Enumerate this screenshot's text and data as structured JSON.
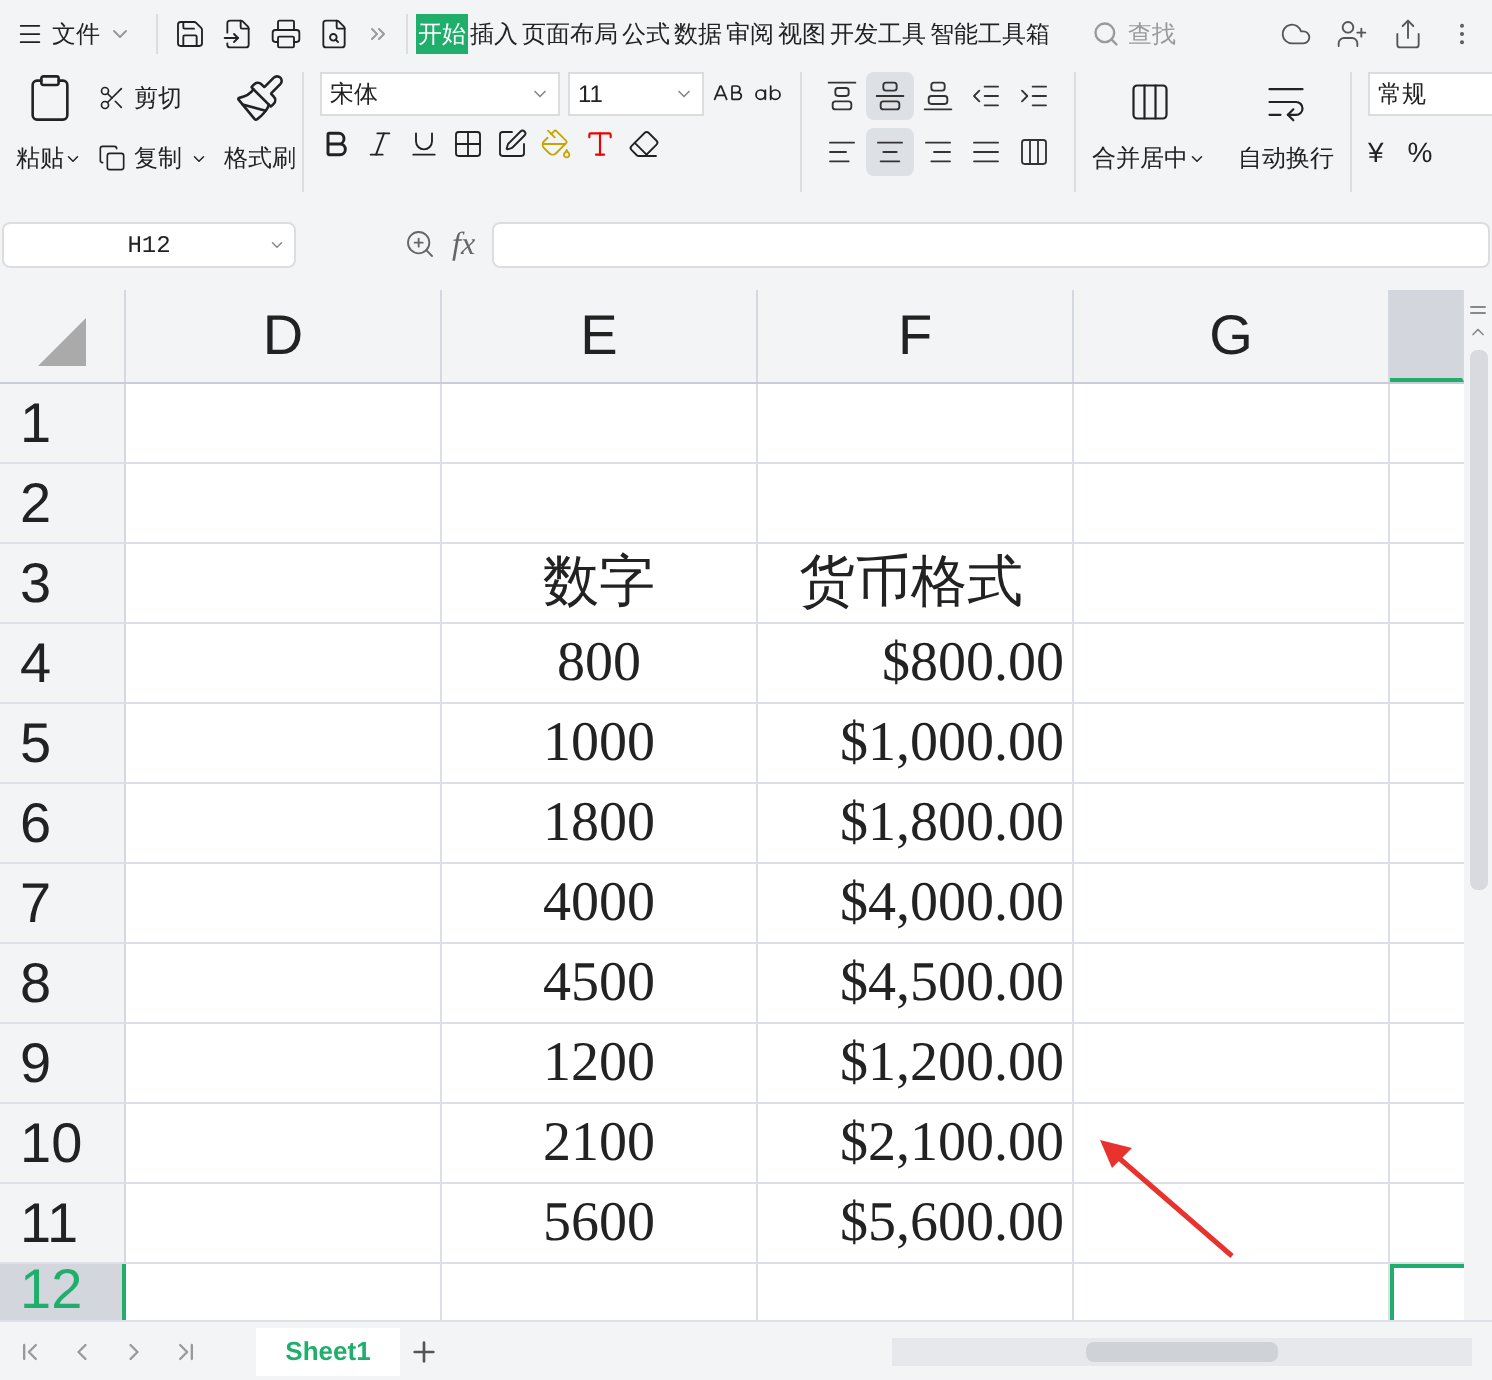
{
  "menu": {
    "label": "文件"
  },
  "ribbon_tabs": [
    {
      "label": "开始",
      "selected": true
    },
    {
      "label": "插入",
      "selected": false
    },
    {
      "label": "页面布局",
      "selected": false
    },
    {
      "label": "公式",
      "selected": false
    },
    {
      "label": "数据",
      "selected": false
    },
    {
      "label": "审阅",
      "selected": false
    },
    {
      "label": "视图",
      "selected": false
    },
    {
      "label": "开发工具",
      "selected": false
    },
    {
      "label": "智能工具箱",
      "selected": false
    }
  ],
  "search": {
    "label": "查找"
  },
  "clipboard": {
    "paste": "粘贴",
    "cut": "剪切",
    "copy": "复制",
    "format_painter": "格式刷"
  },
  "font": {
    "name": "宋体",
    "size": "11"
  },
  "vertical_align": [
    {
      "kind": "top",
      "selected": false
    },
    {
      "kind": "middle",
      "selected": true
    },
    {
      "kind": "bottom",
      "selected": false
    },
    {
      "kind": "outdent",
      "selected": false
    },
    {
      "kind": "indent",
      "selected": false
    }
  ],
  "horizontal_align": [
    {
      "kind": "left",
      "selected": false
    },
    {
      "kind": "center",
      "selected": true
    },
    {
      "kind": "right",
      "selected": false
    },
    {
      "kind": "justify",
      "selected": false
    },
    {
      "kind": "distributed",
      "selected": false
    }
  ],
  "merge_center": "合并居中",
  "wrap_text": "自动换行",
  "number_format": "常规",
  "currency_symbol": "¥",
  "percent_symbol": "%",
  "name_box": "H12",
  "formula_label": "fx",
  "columns": [
    {
      "label": "D",
      "selected": false
    },
    {
      "label": "E",
      "selected": false
    },
    {
      "label": "F",
      "selected": false
    },
    {
      "label": "G",
      "selected": false
    },
    {
      "selected": true
    }
  ],
  "rows": [
    {
      "header": "1",
      "selected": false
    },
    {
      "header": "2",
      "selected": false
    },
    {
      "header": "3",
      "selected": false,
      "kind": "heading",
      "e": "数字",
      "f": "货币格式"
    },
    {
      "header": "4",
      "selected": false,
      "kind": "value",
      "e": "800",
      "f": "$800.00"
    },
    {
      "header": "5",
      "selected": false,
      "kind": "value",
      "e": "1000",
      "f": "$1,000.00"
    },
    {
      "header": "6",
      "selected": false,
      "kind": "value",
      "e": "1800",
      "f": "$1,800.00"
    },
    {
      "header": "7",
      "selected": false,
      "kind": "value",
      "e": "4000",
      "f": "$4,000.00"
    },
    {
      "header": "8",
      "selected": false,
      "kind": "value",
      "e": "4500",
      "f": "$4,500.00"
    },
    {
      "header": "9",
      "selected": false,
      "kind": "value",
      "e": "1200",
      "f": "$1,200.00"
    },
    {
      "header": "10",
      "selected": false,
      "kind": "value",
      "e": "2100",
      "f": "$2,100.00"
    },
    {
      "header": "11",
      "selected": false,
      "kind": "value",
      "e": "5600",
      "f": "$5,600.00"
    },
    {
      "header": "12",
      "selected": true
    }
  ],
  "sheet_tabs": [
    {
      "label": "Sheet1",
      "selected": true
    }
  ]
}
